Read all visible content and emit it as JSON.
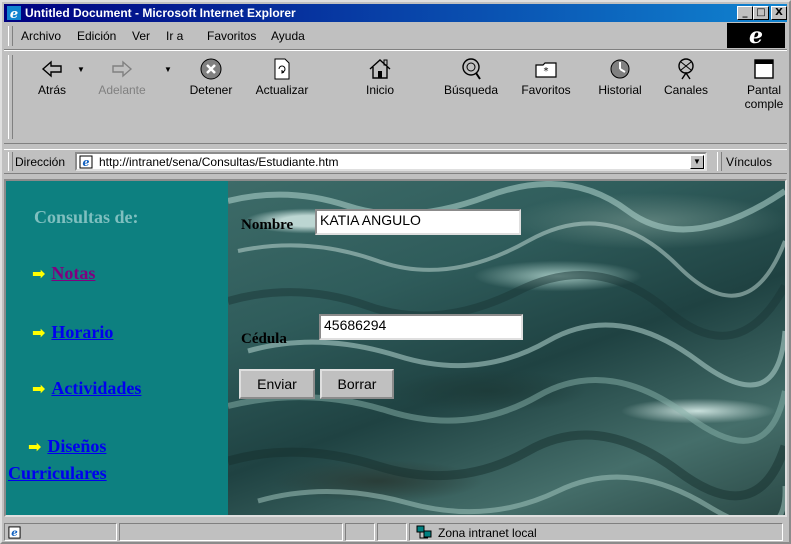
{
  "window": {
    "title": "Untitled Document - Microsoft Internet Explorer",
    "controls": {
      "minimize": "_",
      "maximize": "□",
      "close": "X"
    }
  },
  "menu": {
    "items": [
      {
        "label": "Archivo"
      },
      {
        "label": "Edición"
      },
      {
        "label": "Ver"
      },
      {
        "label": "Ir a"
      },
      {
        "label": "Favoritos"
      },
      {
        "label": "Ayuda"
      }
    ],
    "brand_glyph": "e"
  },
  "toolbar": {
    "buttons": [
      {
        "label": "Atrás",
        "icon": "back-arrow-icon"
      },
      {
        "label": "Adelante",
        "icon": "forward-arrow-icon",
        "disabled": true
      },
      {
        "label": "Detener",
        "icon": "stop-icon"
      },
      {
        "label": "Actualizar",
        "icon": "refresh-icon"
      },
      {
        "label": "Inicio",
        "icon": "home-icon"
      },
      {
        "label": "Búsqueda",
        "icon": "search-icon"
      },
      {
        "label": "Favoritos",
        "icon": "favorites-icon"
      },
      {
        "label": "Historial",
        "icon": "history-icon"
      },
      {
        "label": "Canales",
        "icon": "channels-icon"
      },
      {
        "label": "Pantal",
        "label2": "comple",
        "icon": "fullscreen-icon"
      }
    ]
  },
  "address": {
    "label": "Dirección",
    "url": "http://intranet/sena/Consultas/Estudiante.htm",
    "links_label": "Vínculos"
  },
  "sidebar": {
    "title": "Consultas de:",
    "items": [
      {
        "label": "Notas",
        "visited": true
      },
      {
        "label": "Horario"
      },
      {
        "label": "Actividades"
      },
      {
        "label": "Diseños",
        "label2": "Curriculares"
      }
    ],
    "arrow_glyph": "➡"
  },
  "form": {
    "nombre_label": "Nombre",
    "nombre_value": "KATIA ANGULO",
    "cedula_label": "Cédula",
    "cedula_value": "45686294",
    "submit_label": "Enviar",
    "reset_label": "Borrar"
  },
  "status": {
    "zone": "Zona intranet local"
  },
  "colors": {
    "titlebar": "#000080",
    "sidebar_bg": "#0d8080",
    "link": "#0000ee",
    "visited_link": "#800080",
    "arrow": "#ffff00"
  }
}
